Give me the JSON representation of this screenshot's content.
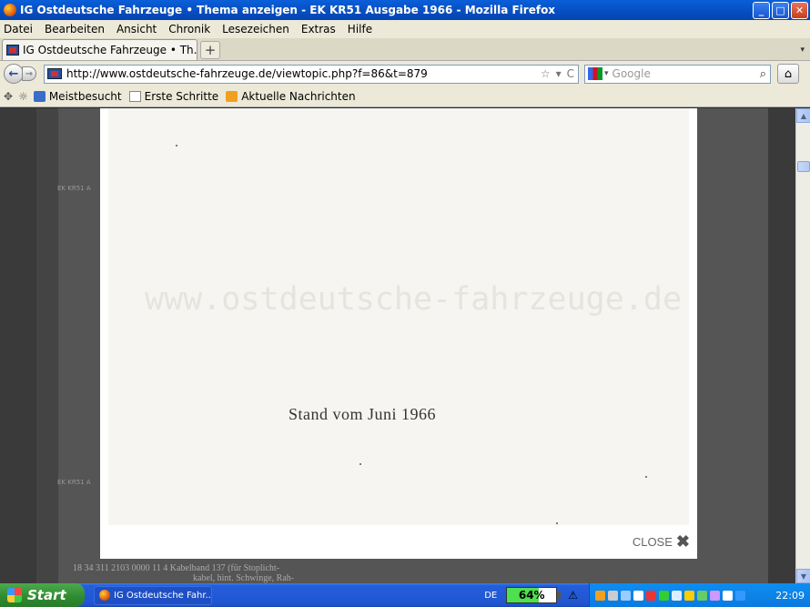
{
  "window": {
    "title": "IG Ostdeutsche Fahrzeuge • Thema anzeigen - EK KR51 Ausgabe 1966 - Mozilla Firefox",
    "minimize": "_",
    "maximize": "□",
    "close": "✕"
  },
  "menu": [
    "Datei",
    "Bearbeiten",
    "Ansicht",
    "Chronik",
    "Lesezeichen",
    "Extras",
    "Hilfe"
  ],
  "tabs": [
    {
      "label": "IG Ostdeutsche Fahrzeuge • Th..."
    }
  ],
  "tabbar": {
    "new_tab": "+",
    "scroll": "▾"
  },
  "nav": {
    "back": "←",
    "forward": "→",
    "url": "http://www.ostdeutsche-fahrzeuge.de/viewtopic.php?f=86&t=879",
    "bookmark_star": "☆",
    "dropdown": "▾",
    "reload": "C",
    "search_placeholder": "Google",
    "search_go": "⌕",
    "home": "⌂"
  },
  "bookmarks": [
    {
      "label": "Meistbesucht",
      "icon": "meistbesucht-icon"
    },
    {
      "label": "Erste Schritte",
      "icon": "page-icon"
    },
    {
      "label": "Aktuelle Nachrichten",
      "icon": "rss-icon"
    }
  ],
  "background_fragments": {
    "label_top": "EK KR51 A",
    "label_bottom": "EK KR51 A",
    "table_row": "18   34 311   2103 0000 11  4   Kabelband 137 (für Stoplicht-",
    "table_row2": "kabel, hint. Schwinge, Rah-"
  },
  "lightbox": {
    "watermark": "www.ostdeutsche-fahrzeuge.de",
    "text": "Stand vom Juni 1966",
    "close_label": "CLOSE",
    "close_icon": "✖"
  },
  "taskbar": {
    "start": "Start",
    "task_item": "IG Ostdeutsche Fahr...",
    "lang": "DE",
    "battery_percent": 64,
    "battery_label": "64%",
    "warning": "⚠",
    "clock": "22:09"
  },
  "colors": {
    "titlebar": "#0853c8",
    "taskbar": "#2155d0",
    "battery_fill": "#4ee04e"
  }
}
